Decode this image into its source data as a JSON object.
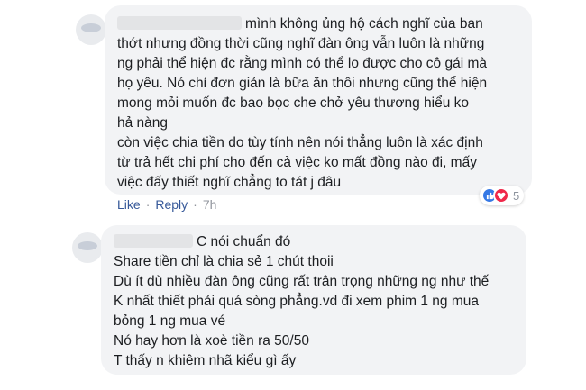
{
  "comments": [
    {
      "lines": [
        "mình không ủng hộ cách nghĩ của ban",
        "thớt nhưng đồng thời cũng nghĩ đàn ông vẫn luôn là những",
        "ng phải thể hiện đc rằng mình có thể lo được cho cô gái mà",
        "họ yêu. Nó chỉ đơn giản là bữa ăn thôi nhưng cũng thể hiện",
        "mong mỏi muốn đc bao bọc che chở yêu thương hiểu ko",
        "hả nàng",
        "còn việc chia tiền do tùy tính nên nói thẳng luôn là xác định",
        "từ trả hết chi phí cho đến cả việc ko mất đồng nào đi, mấy",
        "việc đấy thiết nghĩ chẳng to tát j đâu"
      ],
      "actions": {
        "like": "Like",
        "reply": "Reply",
        "sep": "·",
        "time": "7h"
      },
      "reactions": {
        "count": "5",
        "types": [
          "like-icon",
          "love-icon"
        ],
        "like_color": "#3578e5",
        "love_color": "#f0284a"
      }
    },
    {
      "lines": [
        "C nói chuẩn đó",
        "Share tiền chỉ là chia sẻ 1 chút thoii",
        "Dù ít dù nhiều đàn ông cũng rất trân trọng những ng như thế",
        "K nhất thiết phải quá sòng phẳng.vd đi xem phim 1 ng mua",
        "bỏng 1 ng mua vé",
        "Nó hay hơn là xoè tiền ra 50/50",
        "T thấy n khiêm nhã kiểu gì ấy"
      ]
    }
  ],
  "colors": {
    "bubble": "#f2f3f5",
    "link": "#365899",
    "meta": "#90949c"
  }
}
